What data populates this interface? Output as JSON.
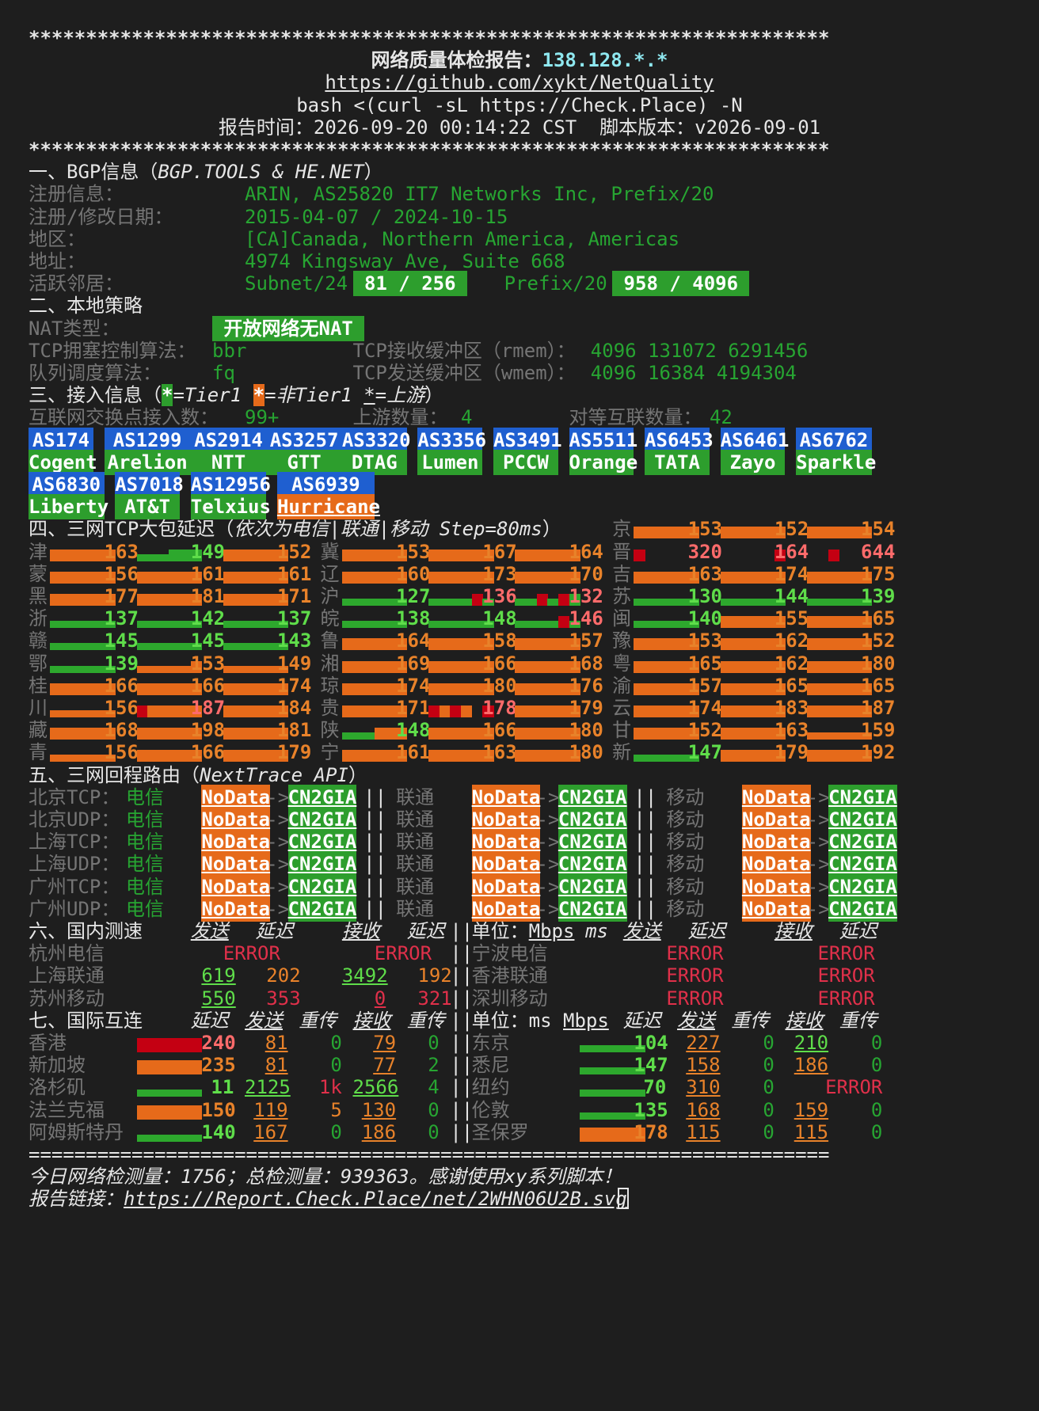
{
  "sep": "**********************************************************************",
  "eqsep": "======================================================================",
  "header": {
    "title_label": "网络质量体检报告：",
    "ip": "138.128.*.*",
    "repo": "https://github.com/xykt/NetQuality",
    "command": "bash <(curl -sL https://Check.Place) -N",
    "time_label": "报告时间：",
    "time": "2026-09-20 00:14:22 CST",
    "version_label": "脚本版本：",
    "version": "v2026-09-01"
  },
  "bgp": {
    "heading": "一、BGP信息（",
    "heading_src": "BGP.TOOLS & HE.NET",
    "heading_end": "）",
    "rows": [
      {
        "label": "注册信息：",
        "value": "ARIN, AS25820 IT7 Networks Inc, Prefix/20"
      },
      {
        "label": "注册/修改日期：",
        "value": "2015-04-07 / 2024-10-15"
      },
      {
        "label": "地区：",
        "value": "[CA]Canada, Northern America, Americas"
      },
      {
        "label": "地址：",
        "value": "4974 Kingsway Ave, Suite 668"
      }
    ],
    "neighbors_label": "活跃邻居：",
    "subnet_label": "Subnet/24",
    "subnet_value": " 81 / 256 ",
    "prefix_label": "Prefix/20",
    "prefix_value": " 958 / 4096 "
  },
  "local": {
    "heading": "二、本地策略",
    "nat_label": "NAT类型：",
    "nat_value": " 开放网络无NAT ",
    "tcp_cc_label": "TCP拥塞控制算法：",
    "tcp_cc_value": "bbr",
    "rmem_label": "TCP接收缓冲区（rmem）：",
    "rmem_value": "4096 131072 6291456",
    "qdisc_label": "队列调度算法：",
    "qdisc_value": "fq",
    "wmem_label": "TCP发送缓冲区（wmem）：",
    "wmem_value": "4096 16384 4194304"
  },
  "access": {
    "heading": "三、接入信息（",
    "star": "*",
    "tier1": "=Tier1 ",
    "nontier1": "=非Tier1 ",
    "upstream": "=上游",
    "heading_end": "）",
    "ixp_label": "互联网交换点接入数：",
    "ixp_value": "99+",
    "up_label": "上游数量：",
    "up_value": "4",
    "peer_label": "对等互联数量：",
    "peer_value": "42",
    "row1": [
      {
        "as": "AS174",
        "name": "Cogent"
      },
      {
        "as": "AS1299",
        "name": "Arelion"
      },
      {
        "as": "AS2914",
        "name": "NTT"
      },
      {
        "as": "AS3257",
        "name": "GTT"
      },
      {
        "as": "AS3320",
        "name": "DTAG"
      },
      {
        "as": "AS3356",
        "name": "Lumen"
      },
      {
        "as": "AS3491",
        "name": "PCCW"
      },
      {
        "as": "AS5511",
        "name": "Orange"
      },
      {
        "as": "AS6453",
        "name": "TATA"
      },
      {
        "as": "AS6461",
        "name": "Zayo"
      },
      {
        "as": "AS6762",
        "name": "Sparkle"
      }
    ],
    "row2": [
      {
        "as": "AS6830",
        "name": "Liberty"
      },
      {
        "as": "AS7018",
        "name": "AT&T"
      },
      {
        "as": "AS12956",
        "name": "Telxius"
      },
      {
        "as": "AS6939",
        "name": "Hurricane"
      }
    ]
  },
  "latency": {
    "heading": "四、三网TCP大包延迟（",
    "heading_italic": "依次为电信|联通|移动 Step=80ms",
    "heading_end": "）",
    "provinces": [
      {
        "name": "京",
        "values": [
          "153",
          "152",
          "154"
        ]
      },
      {
        "name": "津",
        "values": [
          "163",
          "149",
          "152"
        ]
      },
      {
        "name": "冀",
        "values": [
          "153",
          "167",
          "164"
        ]
      },
      {
        "name": "晋",
        "values": [
          "320",
          "164",
          "644"
        ]
      },
      {
        "name": "蒙",
        "values": [
          "156",
          "161",
          "161"
        ]
      },
      {
        "name": "辽",
        "values": [
          "160",
          "173",
          "170"
        ]
      },
      {
        "name": "吉",
        "values": [
          "163",
          "174",
          "175"
        ]
      },
      {
        "name": "黑",
        "values": [
          "177",
          "181",
          "171"
        ]
      },
      {
        "name": "沪",
        "values": [
          "127",
          "136",
          "132"
        ]
      },
      {
        "name": "苏",
        "values": [
          "130",
          "144",
          "139"
        ]
      },
      {
        "name": "浙",
        "values": [
          "137",
          "142",
          "137"
        ]
      },
      {
        "name": "皖",
        "values": [
          "138",
          "148",
          "146"
        ]
      },
      {
        "name": "闽",
        "values": [
          "140",
          "155",
          "165"
        ]
      },
      {
        "name": "赣",
        "values": [
          "145",
          "145",
          "143"
        ]
      },
      {
        "name": "鲁",
        "values": [
          "164",
          "158",
          "157"
        ]
      },
      {
        "name": "豫",
        "values": [
          "153",
          "162",
          "152"
        ]
      },
      {
        "name": "鄂",
        "values": [
          "139",
          "153",
          "149"
        ]
      },
      {
        "name": "湘",
        "values": [
          "169",
          "166",
          "168"
        ]
      },
      {
        "name": "粤",
        "values": [
          "165",
          "162",
          "180"
        ]
      },
      {
        "name": "桂",
        "values": [
          "166",
          "166",
          "174"
        ]
      },
      {
        "name": "琼",
        "values": [
          "174",
          "180",
          "176"
        ]
      },
      {
        "name": "渝",
        "values": [
          "157",
          "165",
          "165"
        ]
      },
      {
        "name": "川",
        "values": [
          "156",
          "187",
          "184"
        ]
      },
      {
        "name": "贵",
        "values": [
          "171",
          "178",
          "179"
        ]
      },
      {
        "name": "云",
        "values": [
          "174",
          "183",
          "187"
        ]
      },
      {
        "name": "藏",
        "values": [
          "168",
          "198",
          "181"
        ]
      },
      {
        "name": "陕",
        "values": [
          "148",
          "166",
          "180"
        ]
      },
      {
        "name": "甘",
        "values": [
          "152",
          "163",
          "159"
        ]
      },
      {
        "name": "青",
        "values": [
          "156",
          "166",
          "179"
        ]
      },
      {
        "name": "宁",
        "values": [
          "161",
          "163",
          "180"
        ]
      },
      {
        "name": "新",
        "values": [
          "147",
          "179",
          "192"
        ]
      }
    ]
  },
  "route": {
    "heading": "五、三网回程路由（",
    "heading_italic": "NextTrace API",
    "heading_end": "）",
    "telecom": "电信",
    "unicom": "联通",
    "mobile": "移动",
    "nodata": "NoData",
    "arrow": "->",
    "cn2": "CN2GIA",
    "sep": "||",
    "rows": [
      "北京TCP：",
      "北京UDP：",
      "上海TCP：",
      "上海UDP：",
      "广州TCP：",
      "广州UDP："
    ]
  },
  "domestic": {
    "heading": "六、国内测速",
    "send": "发送",
    "delay": "延迟",
    "recv": "接收",
    "unit_label": "单位：",
    "mbps": "Mbps",
    "ms": "ms",
    "error": "ERROR",
    "sep": "||",
    "left": [
      {
        "name": "杭州电信",
        "error": true
      },
      {
        "name": "上海联通",
        "send": "619",
        "sdelay": "202",
        "recv": "3492",
        "rdelay": "192"
      },
      {
        "name": "苏州移动",
        "send": "550",
        "sdelay": "353",
        "recv": "0",
        "rdelay": "321"
      }
    ],
    "right": [
      {
        "name": "宁波电信"
      },
      {
        "name": "香港联通"
      },
      {
        "name": "深圳移动"
      }
    ]
  },
  "intl": {
    "heading": "七、国际互连",
    "delay": "延迟",
    "send": "发送",
    "retrans": "重传",
    "recv": "接收",
    "unit_label": "单位：",
    "ms": "ms",
    "mbps": "Mbps",
    "sep": "||",
    "left": [
      {
        "name": "香港",
        "delay": "240",
        "send": "81",
        "sret": "0",
        "recv": "79",
        "rret": "0"
      },
      {
        "name": "新加坡",
        "delay": "235",
        "send": "81",
        "sret": "0",
        "recv": "77",
        "rret": "2"
      },
      {
        "name": "洛杉矶",
        "delay": "11",
        "send": "2125",
        "sret": "1k",
        "recv": "2566",
        "rret": "4"
      },
      {
        "name": "法兰克福",
        "delay": "150",
        "send": "119",
        "sret": "5",
        "recv": "130",
        "rret": "0"
      },
      {
        "name": "阿姆斯特丹",
        "delay": "140",
        "send": "167",
        "sret": "0",
        "recv": "186",
        "rret": "0"
      }
    ],
    "right": [
      {
        "name": "东京",
        "delay": "104",
        "send": "227",
        "sret": "0",
        "recv": "210",
        "rret": "0"
      },
      {
        "name": "悉尼",
        "delay": "147",
        "send": "158",
        "sret": "0",
        "recv": "186",
        "rret": "0"
      },
      {
        "name": "纽约",
        "delay": "70",
        "send": "310",
        "sret": "0",
        "recv": "ERROR"
      },
      {
        "name": "伦敦",
        "delay": "135",
        "send": "168",
        "sret": "0",
        "recv": "159",
        "rret": "0"
      },
      {
        "name": "圣保罗",
        "delay": "178",
        "send": "115",
        "sret": "0",
        "recv": "115",
        "rret": "0"
      }
    ]
  },
  "footer": {
    "stats": "今日网络检测量：1756；总检测量：939363。感谢使用xy系列脚本！",
    "link_label": "报告链接：",
    "link": "https://Report.Check.Place/net/2WHN06U2B.svg"
  },
  "colors": {
    "bg": "#1e1e1e",
    "green": "#27a532",
    "orange": "#e66a1a",
    "blue": "#1f5fd0",
    "red": "#c00000"
  }
}
